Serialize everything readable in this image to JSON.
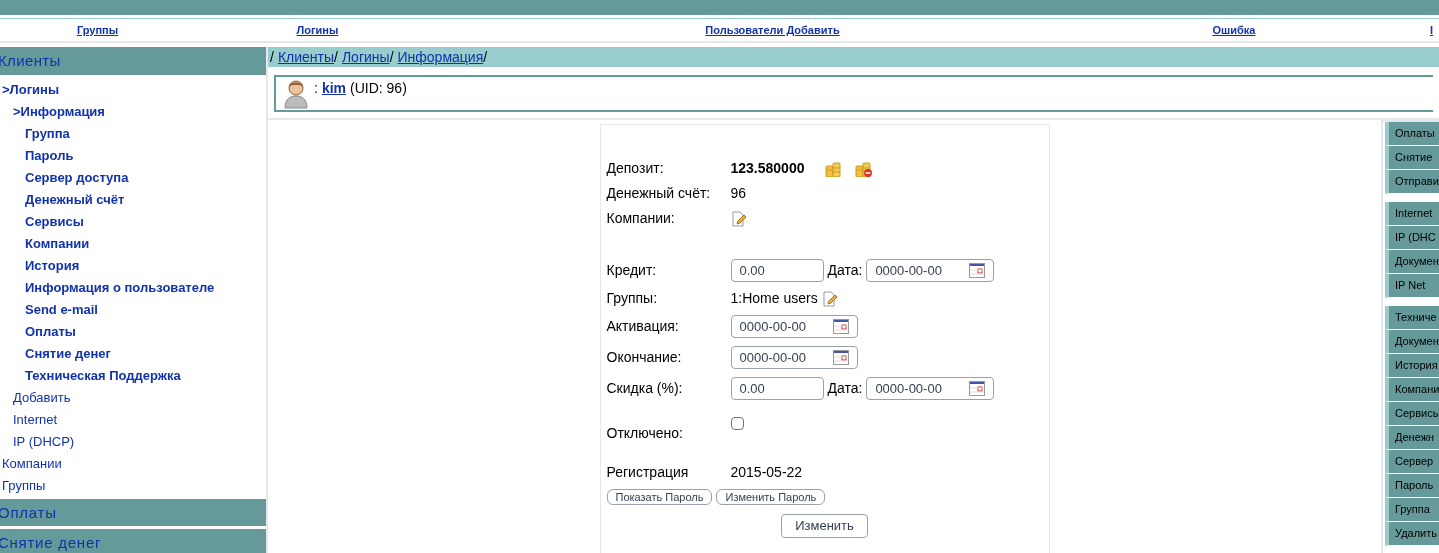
{
  "nav": [
    {
      "label": "Группы"
    },
    {
      "label": "Логины"
    },
    {
      "label": "Пользователи Добавить"
    },
    {
      "label": "Ошибка"
    },
    {
      "label": "I"
    }
  ],
  "sidebar": {
    "header": "Клиенты",
    "items": [
      {
        "label": ">Логины",
        "highlighted": true,
        "children": [
          {
            "label": ">Информация",
            "highlighted": true,
            "children": [
              {
                "label": "Группа",
                "highlighted": true
              },
              {
                "label": "Пароль",
                "highlighted": true
              },
              {
                "label": "Сервер доступа",
                "highlighted": true
              },
              {
                "label": "Денежный счёт",
                "highlighted": true
              },
              {
                "label": "Сервисы",
                "highlighted": true
              },
              {
                "label": "Компании",
                "highlighted": true
              },
              {
                "label": "История",
                "highlighted": true
              },
              {
                "label": "Информация о пользователе",
                "highlighted": true
              },
              {
                "label": "Send e-mail",
                "highlighted": true
              },
              {
                "label": "Оплаты",
                "highlighted": true
              },
              {
                "label": "Снятие денег",
                "highlighted": true
              },
              {
                "label": "Техническая Поддержка",
                "highlighted": true
              }
            ]
          },
          {
            "label": "Добавить",
            "highlighted": false
          },
          {
            "label": "Internet",
            "highlighted": false
          },
          {
            "label": "IP (DHCP)",
            "highlighted": false
          }
        ]
      },
      {
        "label": "Компании",
        "highlighted": false
      },
      {
        "label": "Группы",
        "highlighted": false
      }
    ],
    "sections": [
      "Оплаты",
      "Снятие денег"
    ]
  },
  "breadcrumb": [
    {
      "kind": "sep",
      "text": "/"
    },
    {
      "kind": "link",
      "text": "Клиенты"
    },
    {
      "kind": "sep",
      "text": "/"
    },
    {
      "kind": "link",
      "text": "Логины"
    },
    {
      "kind": "sep",
      "text": "/"
    },
    {
      "kind": "link",
      "text": "Информация"
    },
    {
      "kind": "sep",
      "text": "/"
    }
  ],
  "user": {
    "prefix": ":",
    "login": "kim",
    "uid": "(UID: 96)"
  },
  "form": {
    "rows": [
      {
        "kind": "deposit",
        "label": "Депозит:",
        "value": "123.580000"
      },
      {
        "kind": "text",
        "label": "Денежный счёт:",
        "value": "96"
      },
      {
        "kind": "edit",
        "label": "Компании:"
      },
      {
        "kind": "amount_date",
        "label": "Кредит:",
        "value": "0.00",
        "date_label": "Дата:",
        "date": "0000-00-00"
      },
      {
        "kind": "group",
        "label": "Группы:",
        "value": "1:Home users"
      },
      {
        "kind": "date",
        "label": "Активация:",
        "date": "0000-00-00"
      },
      {
        "kind": "date",
        "label": "Окончание:",
        "date": "0000-00-00"
      },
      {
        "kind": "amount_date",
        "label": "Скидка (%):",
        "value": "0.00",
        "date_label": "Дата:",
        "date": "0000-00-00"
      },
      {
        "kind": "checkbox",
        "label": "Отключено:",
        "checked": false
      },
      {
        "kind": "text",
        "label": "Регистрация",
        "value": "2015-05-22"
      }
    ],
    "buttons": [
      "Показать Пароль",
      "Изменить Пароль"
    ],
    "submit": "Изменить"
  },
  "right_menu": [
    [
      "Оплаты",
      "Снятие",
      "Отправи"
    ],
    [
      "Internet",
      "IP (DHC",
      "Докумен",
      "IP Net"
    ],
    [
      "Техниче",
      "Докумен",
      "История",
      "Компани",
      "Сервисы",
      "Денежн",
      "Сервер",
      "Пароль",
      "Группа",
      "Удалить"
    ]
  ]
}
